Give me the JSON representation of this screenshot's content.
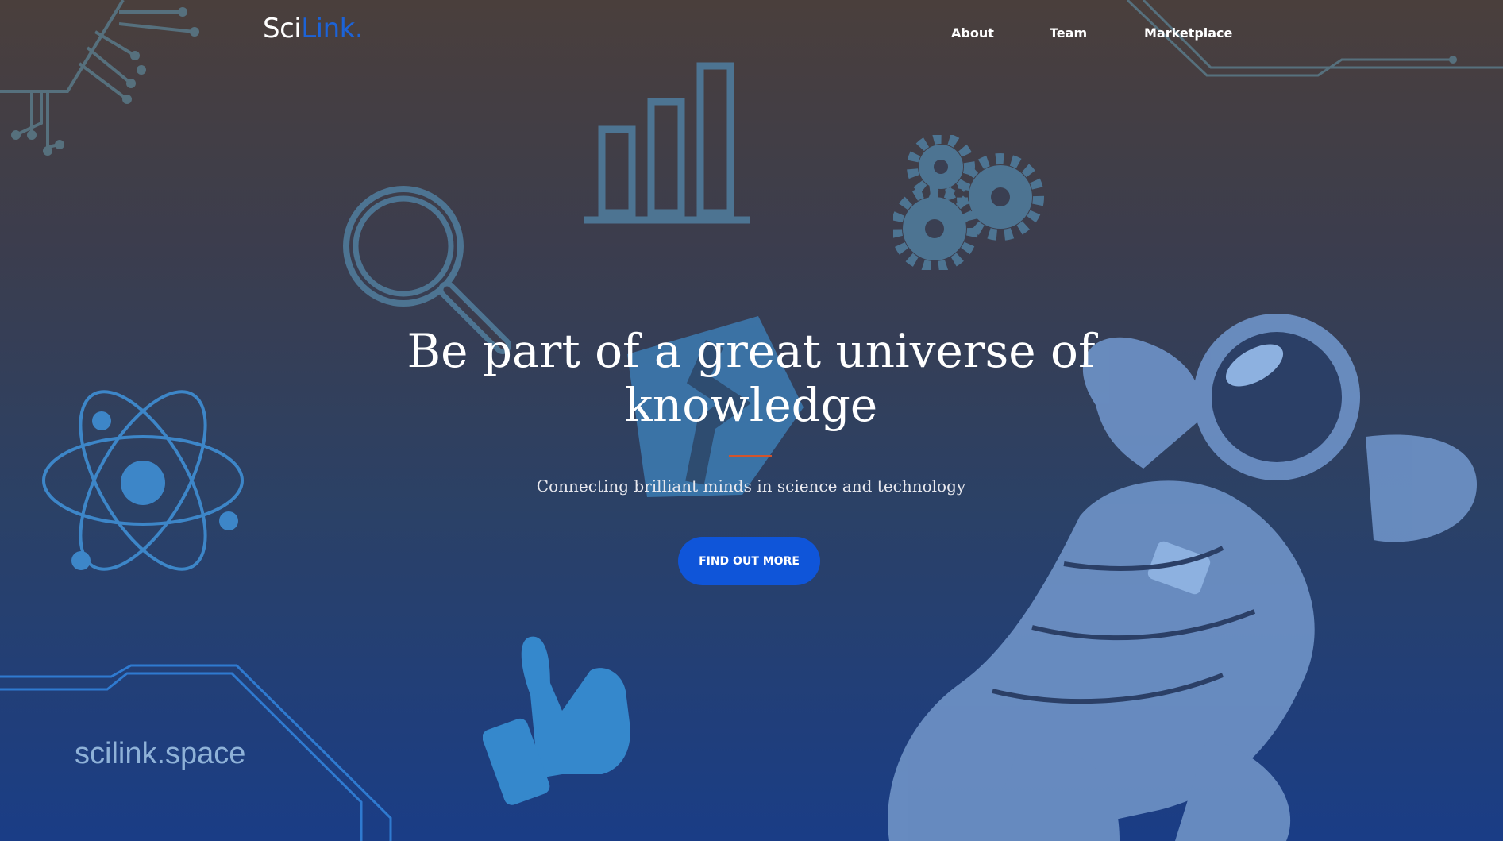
{
  "nav": {
    "logo_part1": "Sci",
    "logo_part2": "Link.",
    "links": [
      "About",
      "Team",
      "Marketplace"
    ]
  },
  "hero": {
    "headline_line1": "Be part of a great universe of",
    "headline_line2": "knowledge",
    "subtitle": "Connecting brilliant minds in science and technology",
    "cta_label": "FIND OUT MORE",
    "domain_text": "scilink.space"
  },
  "colors": {
    "accent_blue": "#0f55d9",
    "logo_blue": "#1c63d8",
    "divider_orange": "#d2542c",
    "icon_blue": "#3d86c8"
  },
  "icons": [
    "circuit-icon",
    "bar-chart-icon",
    "magnifier-icon",
    "gears-icon",
    "atom-icon",
    "center-logo-icon",
    "thumbs-up-icon",
    "astronaut-illustration",
    "circuit-frame-icon"
  ]
}
